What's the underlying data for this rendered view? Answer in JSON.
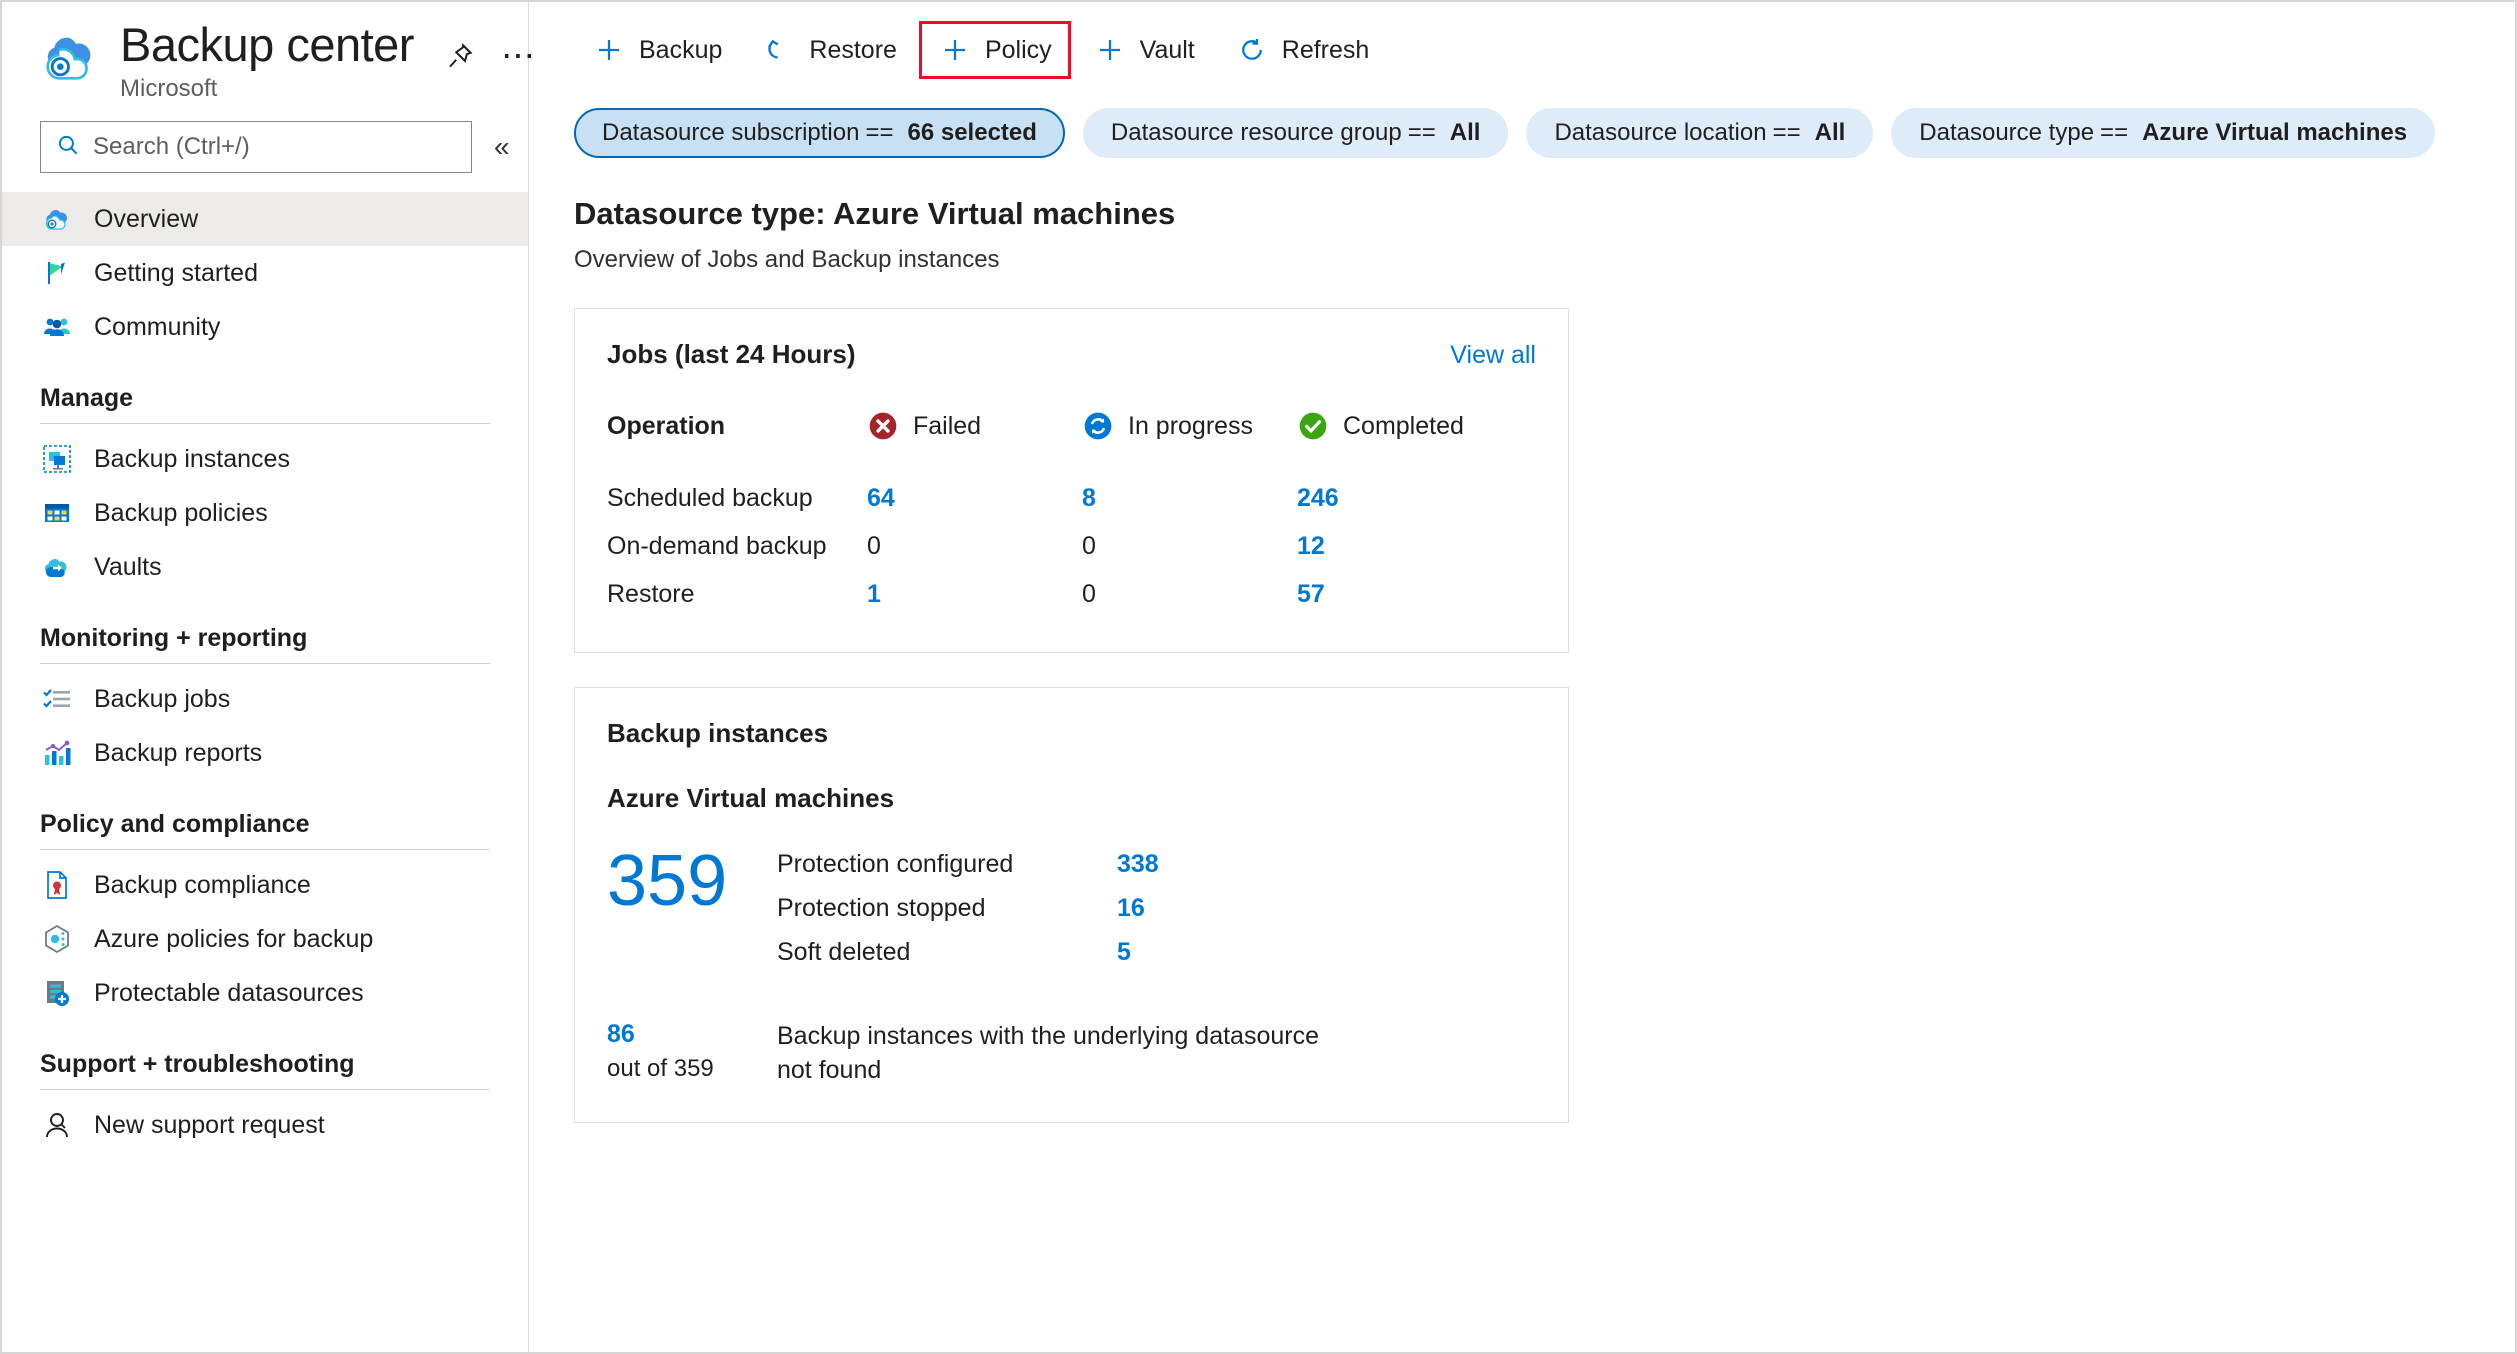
{
  "header": {
    "title": "Backup center",
    "subtitle": "Microsoft",
    "pin_icon": "pin-icon",
    "more_icon": "ellipsis-icon"
  },
  "search": {
    "placeholder": "Search (Ctrl+/)",
    "value": "",
    "icon": "search-icon",
    "collapse_icon": "chevron-double-left-icon"
  },
  "sidebar": {
    "items": [
      {
        "label": "Overview",
        "icon": "cloud-backup-icon",
        "selected": true
      },
      {
        "label": "Getting started",
        "icon": "flag-icon",
        "selected": false
      },
      {
        "label": "Community",
        "icon": "people-icon",
        "selected": false
      }
    ],
    "groups": [
      {
        "title": "Manage",
        "items": [
          {
            "label": "Backup instances",
            "icon": "backup-instance-icon"
          },
          {
            "label": "Backup policies",
            "icon": "policy-grid-icon"
          },
          {
            "label": "Vaults",
            "icon": "vault-cloud-icon"
          }
        ]
      },
      {
        "title": "Monitoring + reporting",
        "items": [
          {
            "label": "Backup jobs",
            "icon": "checklist-icon"
          },
          {
            "label": "Backup reports",
            "icon": "bar-chart-icon"
          }
        ]
      },
      {
        "title": "Policy and compliance",
        "items": [
          {
            "label": "Backup compliance",
            "icon": "compliance-document-icon"
          },
          {
            "label": "Azure policies for backup",
            "icon": "azure-policy-icon"
          },
          {
            "label": "Protectable datasources",
            "icon": "protectable-datasource-icon"
          }
        ]
      },
      {
        "title": "Support + troubleshooting",
        "items": [
          {
            "label": "New support request",
            "icon": "support-person-icon"
          }
        ]
      }
    ]
  },
  "toolbar": {
    "commands": [
      {
        "label": "Backup",
        "icon": "plus-icon",
        "highlighted": false
      },
      {
        "label": "Restore",
        "icon": "restore-arrow-icon",
        "highlighted": false
      },
      {
        "label": "Policy",
        "icon": "plus-icon",
        "highlighted": true
      },
      {
        "label": "Vault",
        "icon": "plus-icon",
        "highlighted": false
      },
      {
        "label": "Refresh",
        "icon": "refresh-icon",
        "highlighted": false
      }
    ],
    "highlight_color": "#e81123"
  },
  "filters": [
    {
      "name": "Datasource subscription",
      "op": "==",
      "value": "66 selected",
      "active": true
    },
    {
      "name": "Datasource resource group",
      "op": "==",
      "value": "All",
      "active": false
    },
    {
      "name": "Datasource location",
      "op": "==",
      "value": "All",
      "active": false
    },
    {
      "name": "Datasource type",
      "op": "==",
      "value": "Azure Virtual machines",
      "active": false
    }
  ],
  "main": {
    "title": "Datasource type: Azure Virtual machines",
    "subtitle": "Overview of Jobs and Backup instances"
  },
  "jobs_card": {
    "title": "Jobs (last 24 Hours)",
    "view_all": "View all",
    "operation_header": "Operation",
    "status_columns": [
      {
        "label": "Failed",
        "icon": "error-circle-icon",
        "color": "#a4262c"
      },
      {
        "label": "In progress",
        "icon": "sync-circle-icon",
        "color": "#0078d4"
      },
      {
        "label": "Completed",
        "icon": "success-circle-icon",
        "color": "#107c10"
      }
    ],
    "rows": [
      {
        "operation": "Scheduled backup",
        "failed": "64",
        "in_progress": "8",
        "completed": "246"
      },
      {
        "operation": "On-demand backup",
        "failed": "0",
        "in_progress": "0",
        "completed": "12"
      },
      {
        "operation": "Restore",
        "failed": "1",
        "in_progress": "0",
        "completed": "57"
      }
    ]
  },
  "instances_card": {
    "title": "Backup instances",
    "subtitle": "Azure Virtual machines",
    "total": "359",
    "breakdown": [
      {
        "label": "Protection configured",
        "value": "338"
      },
      {
        "label": "Protection stopped",
        "value": "16"
      },
      {
        "label": "Soft deleted",
        "value": "5"
      }
    ],
    "footer": {
      "count": "86",
      "out_of": "out of 359",
      "description": "Backup instances with the underlying datasource not found"
    }
  },
  "chart_data": {
    "type": "table",
    "title": "Jobs (last 24 Hours)",
    "categories": [
      "Scheduled backup",
      "On-demand backup",
      "Restore"
    ],
    "series": [
      {
        "name": "Failed",
        "values": [
          64,
          0,
          1
        ]
      },
      {
        "name": "In progress",
        "values": [
          8,
          0,
          0
        ]
      },
      {
        "name": "Completed",
        "values": [
          246,
          12,
          57
        ]
      }
    ],
    "secondary": {
      "type": "table",
      "title": "Backup instances - Azure Virtual machines",
      "total": 359,
      "categories": [
        "Protection configured",
        "Protection stopped",
        "Soft deleted",
        "Datasource not found"
      ],
      "values": [
        338,
        16,
        5,
        86
      ]
    }
  }
}
